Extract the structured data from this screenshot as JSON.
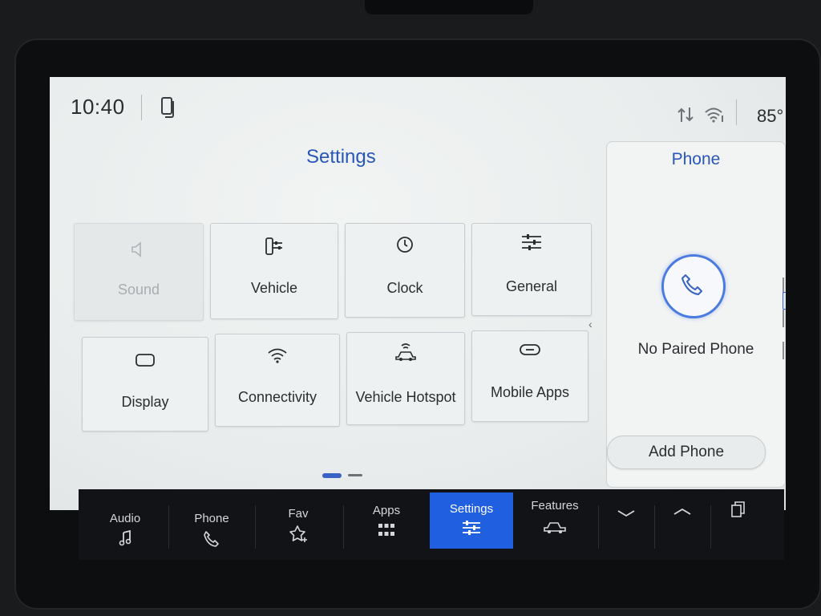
{
  "status": {
    "time": "10:40",
    "temperature": "85°",
    "icons": [
      "phone-projection-icon",
      "data-transfer-icon",
      "wifi-icon"
    ]
  },
  "settings": {
    "title": "Settings",
    "tiles": [
      {
        "label": "Sound",
        "icon": "speaker-icon",
        "enabled": false
      },
      {
        "label": "Vehicle",
        "icon": "vehicle-settings-icon",
        "enabled": true
      },
      {
        "label": "Clock",
        "icon": "clock-icon",
        "enabled": true
      },
      {
        "label": "General",
        "icon": "sliders-icon",
        "enabled": true
      },
      {
        "label": "Display",
        "icon": "display-icon",
        "enabled": true
      },
      {
        "label": "Connectivity",
        "icon": "wifi-icon",
        "enabled": true
      },
      {
        "label": "Vehicle Hotspot",
        "icon": "hotspot-icon",
        "enabled": true
      },
      {
        "label": "Mobile Apps",
        "icon": "link-icon",
        "enabled": true
      }
    ],
    "page_indicator": {
      "current": 1,
      "total": 2
    }
  },
  "phone_panel": {
    "title": "Phone",
    "status": "No Paired Phone",
    "add_button": "Add Phone"
  },
  "nav": {
    "items": [
      {
        "label": "Audio",
        "icon": "music-note-icon"
      },
      {
        "label": "Phone",
        "icon": "phone-icon"
      },
      {
        "label": "Fav",
        "icon": "star-icon"
      },
      {
        "label": "Apps",
        "icon": "grid-icon"
      },
      {
        "label": "Settings",
        "icon": "sliders-icon",
        "active": true
      },
      {
        "label": "Features",
        "icon": "truck-icon"
      }
    ],
    "controls": [
      "chevron-down-icon",
      "chevron-up-icon",
      "copy-icon"
    ],
    "active_color": "#1f5fe0"
  }
}
